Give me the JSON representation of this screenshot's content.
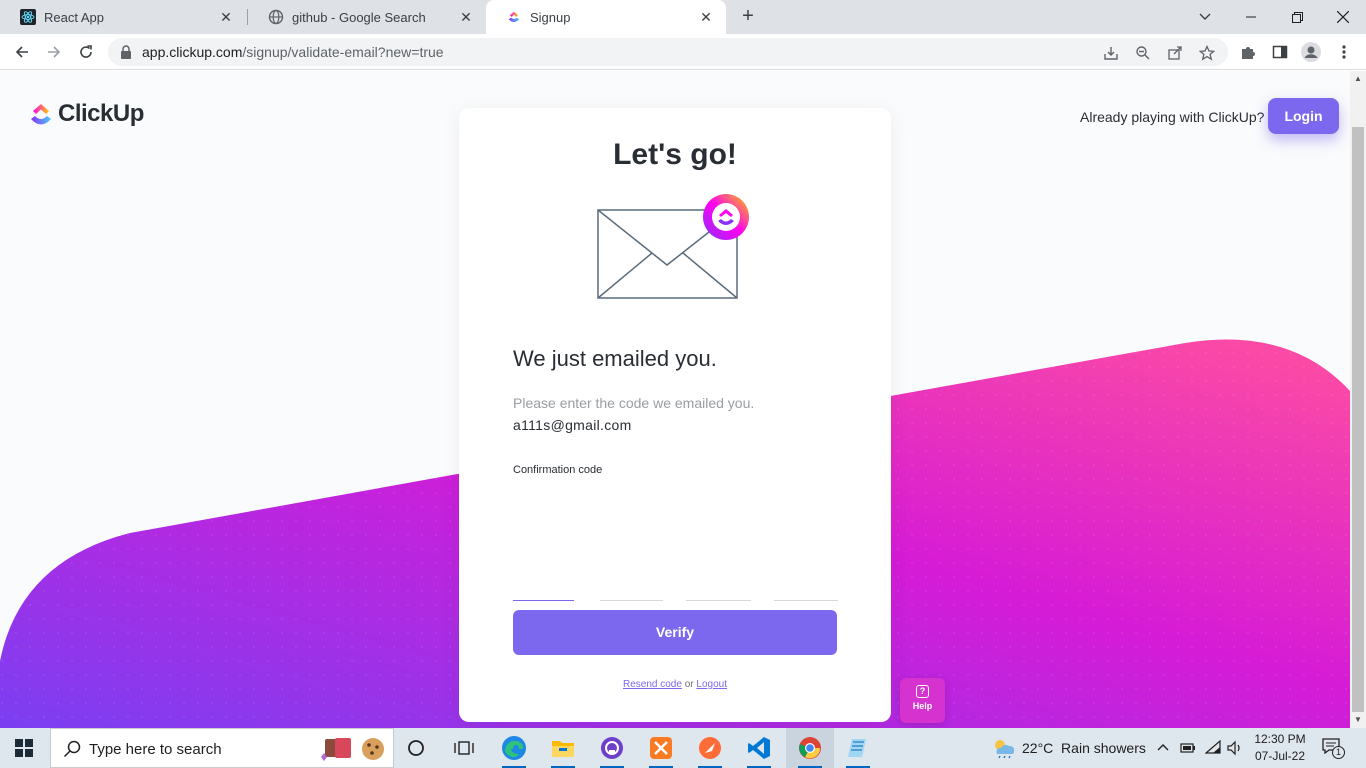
{
  "browser": {
    "tabs": [
      {
        "title": "React App",
        "active": false
      },
      {
        "title": "github - Google Search",
        "active": false
      },
      {
        "title": "Signup",
        "active": true
      }
    ],
    "url_host": "app.clickup.com",
    "url_path": "/signup/validate-email?new=true"
  },
  "header": {
    "brand": "ClickUp",
    "already_text": "Already playing with ClickUp?",
    "login_label": "Login"
  },
  "card": {
    "title": "Let's go!",
    "heading": "We just emailed you.",
    "subtext": "Please enter the code we emailed you.",
    "email": "a111s@gmail.com",
    "code_label": "Confirmation code",
    "code_values": [
      "",
      "",
      "",
      ""
    ],
    "verify_label": "Verify",
    "resend_label": "Resend code",
    "or_text": "or",
    "logout_label": "Logout"
  },
  "help": {
    "label": "Help"
  },
  "taskbar": {
    "search_placeholder": "Type here to search",
    "weather": "22°C  Rain showers",
    "time": "12:30 PM",
    "date": "07-Jul-22",
    "notification_count": "1"
  },
  "colors": {
    "accent": "#7b68ee",
    "wave_start": "#7b3ff2",
    "wave_mid": "#d61bd6",
    "wave_end": "#ff4fa0"
  }
}
